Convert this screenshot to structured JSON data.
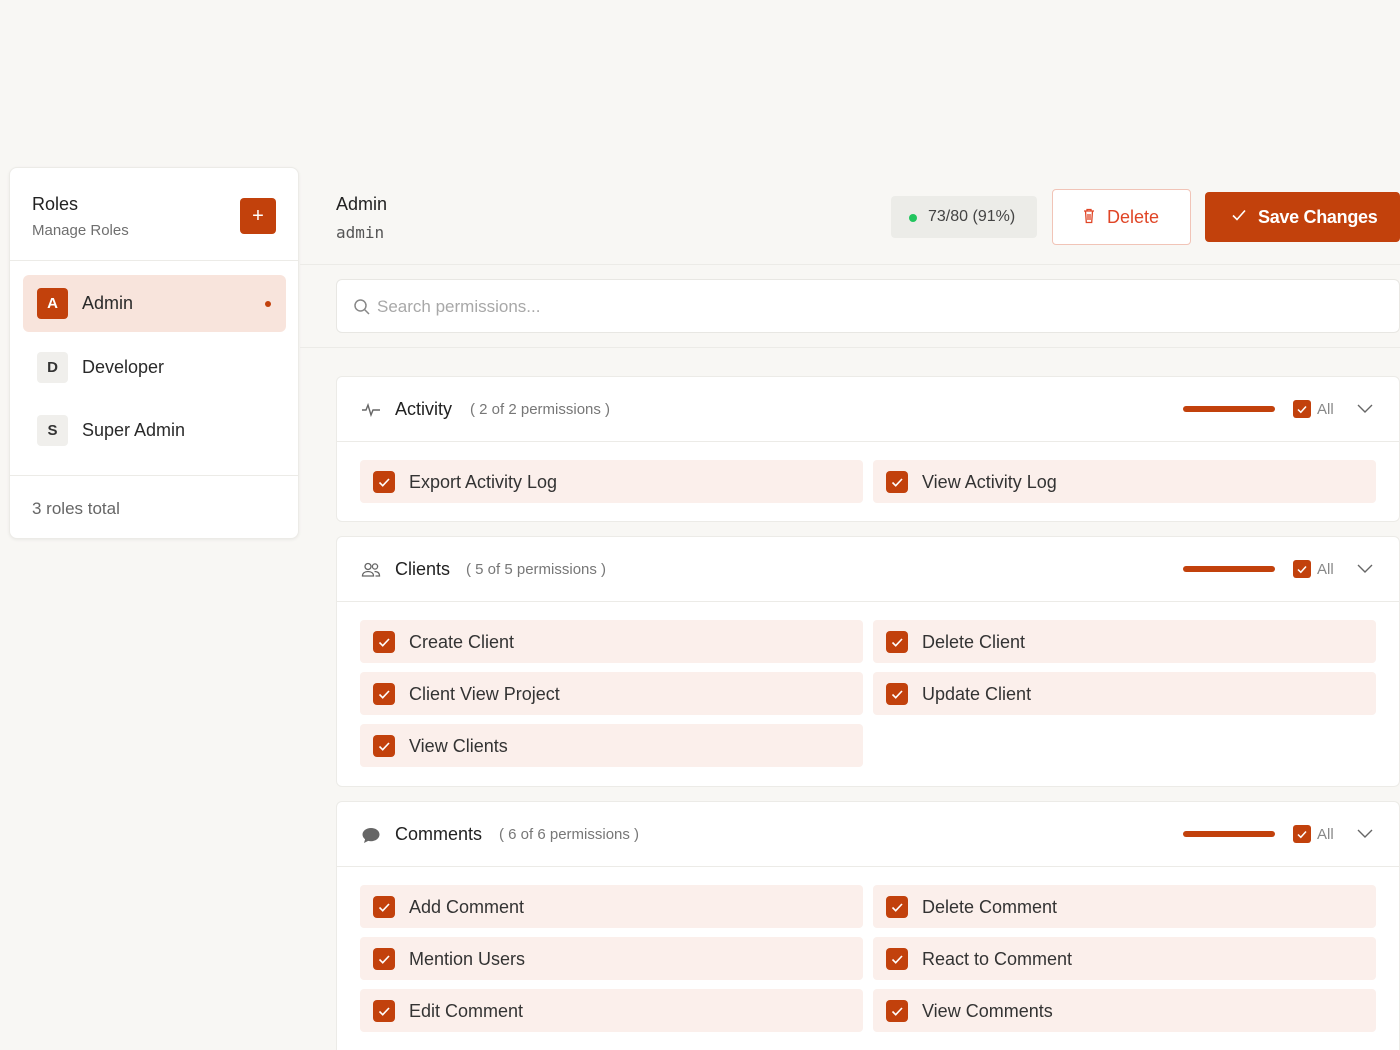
{
  "sidebar": {
    "title": "Roles",
    "subtitle": "Manage Roles",
    "add_label": "+",
    "roles": [
      {
        "initial": "A",
        "name": "Admin"
      },
      {
        "initial": "D",
        "name": "Developer"
      },
      {
        "initial": "S",
        "name": "Super Admin"
      }
    ],
    "footer": "3 roles total"
  },
  "header": {
    "role_title": "Admin",
    "role_slug": "admin",
    "stat": "73/80 (91%)",
    "delete_label": "Delete",
    "save_label": "Save Changes"
  },
  "search": {
    "placeholder": "Search permissions..."
  },
  "colors": {
    "accent": "#c2410c",
    "status": "#22c55e",
    "danger": "#e04526"
  },
  "sections": [
    {
      "name": "Activity",
      "icon": "activity-icon",
      "count": "( 2 of 2 permissions )",
      "all_label": "All",
      "progress": 1.0,
      "permissions": [
        "Export Activity Log",
        "View Activity Log"
      ]
    },
    {
      "name": "Clients",
      "icon": "users-icon",
      "count": "( 5 of 5 permissions )",
      "all_label": "All",
      "progress": 1.0,
      "permissions": [
        "Create Client",
        "Delete Client",
        "Client View Project",
        "Update Client",
        "View Clients"
      ]
    },
    {
      "name": "Comments",
      "icon": "comment-icon",
      "count": "( 6 of 6 permissions )",
      "all_label": "All",
      "progress": 1.0,
      "permissions": [
        "Add Comment",
        "Delete Comment",
        "Mention Users",
        "React to Comment",
        "Edit Comment",
        "View Comments"
      ]
    }
  ]
}
